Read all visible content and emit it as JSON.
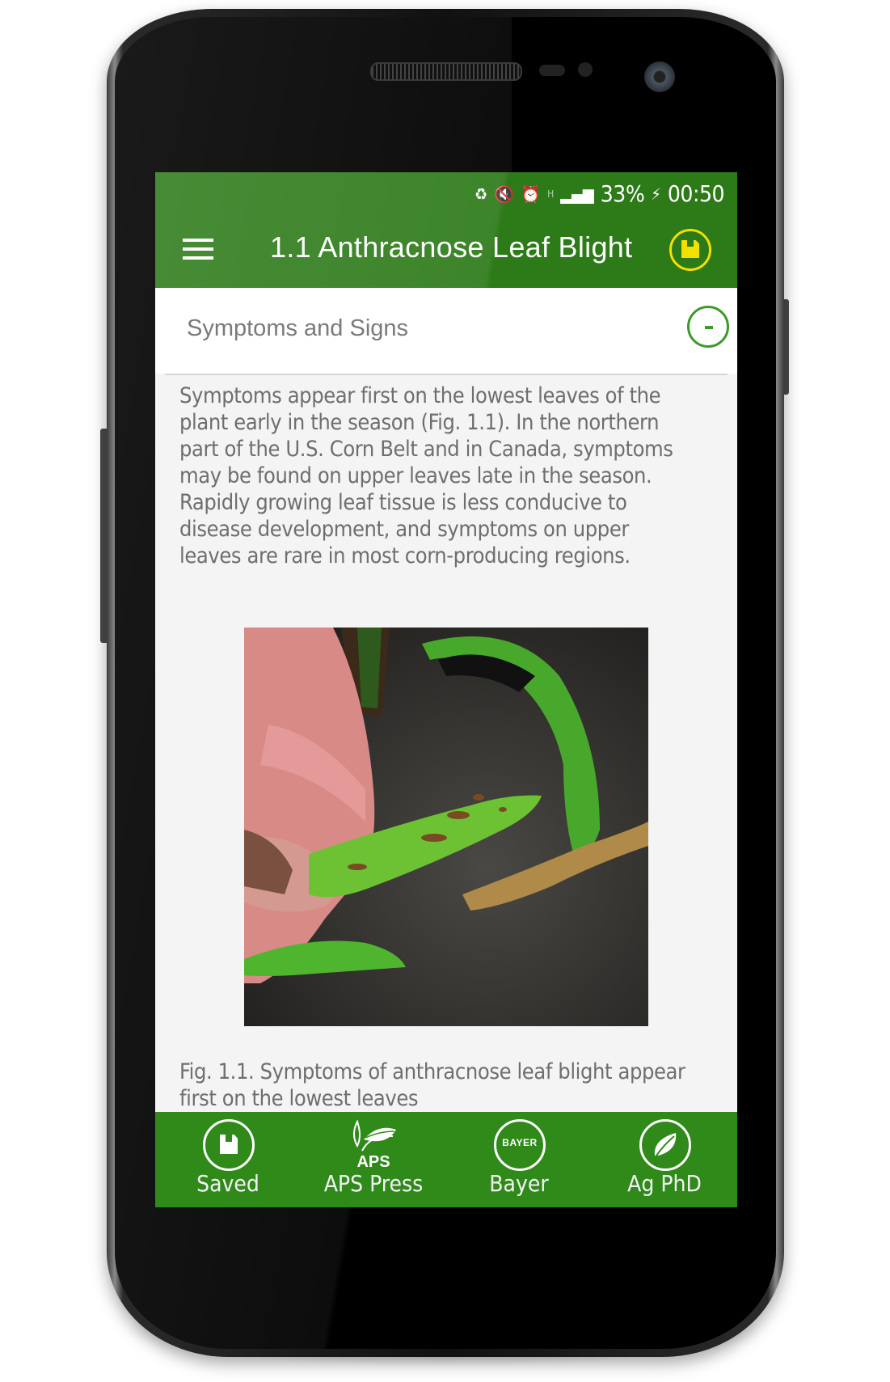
{
  "status_bar": {
    "icons": [
      "battery-saver-icon",
      "vibrate-mute-icon",
      "alarm-icon",
      "network-h-icon",
      "signal-icon",
      "charging-battery-icon"
    ],
    "battery": "33%",
    "time": "00:50"
  },
  "app_bar": {
    "menu_icon": "hamburger-menu-icon",
    "title": "1.1 Anthracnose Leaf Blight",
    "save_icon": "floppy-disk-icon"
  },
  "section": {
    "title": "Symptoms and Signs",
    "collapse_icon": "minus-circle-icon",
    "body": "Symptoms appear first on the lowest leaves of the\nplant early in the season (Fig. 1.1). In the northern\npart of the U.S. Corn Belt and in Canada, symptoms\nmay be found on upper leaves late in the season.\nRapidly growing leaf tissue is less conducive to\ndisease development, and symptoms on upper\nleaves are rare in most corn-producing regions.",
    "figure_alt": "Hand holding corn leaf with anthracnose leaf blight lesions",
    "caption": "Fig. 1.1. Symptoms of anthracnose leaf blight appear\nfirst on the lowest leaves"
  },
  "bottom_nav": {
    "items": [
      {
        "label": "Saved",
        "icon": "floppy-disk-icon"
      },
      {
        "label": "APS Press",
        "icon": "aps-logo-icon",
        "logo_text": "APS"
      },
      {
        "label": "Bayer",
        "icon": "bayer-cross-icon",
        "logo_text": "BAYER"
      },
      {
        "label": "Ag PhD",
        "icon": "leaf-icon"
      }
    ]
  },
  "colors": {
    "primary_green": "#2c7a18",
    "nav_green": "#2f8a1a",
    "accent_yellow": "#f4e000",
    "collapse_green": "#3c9a28",
    "text_gray": "#6e6e6e"
  }
}
